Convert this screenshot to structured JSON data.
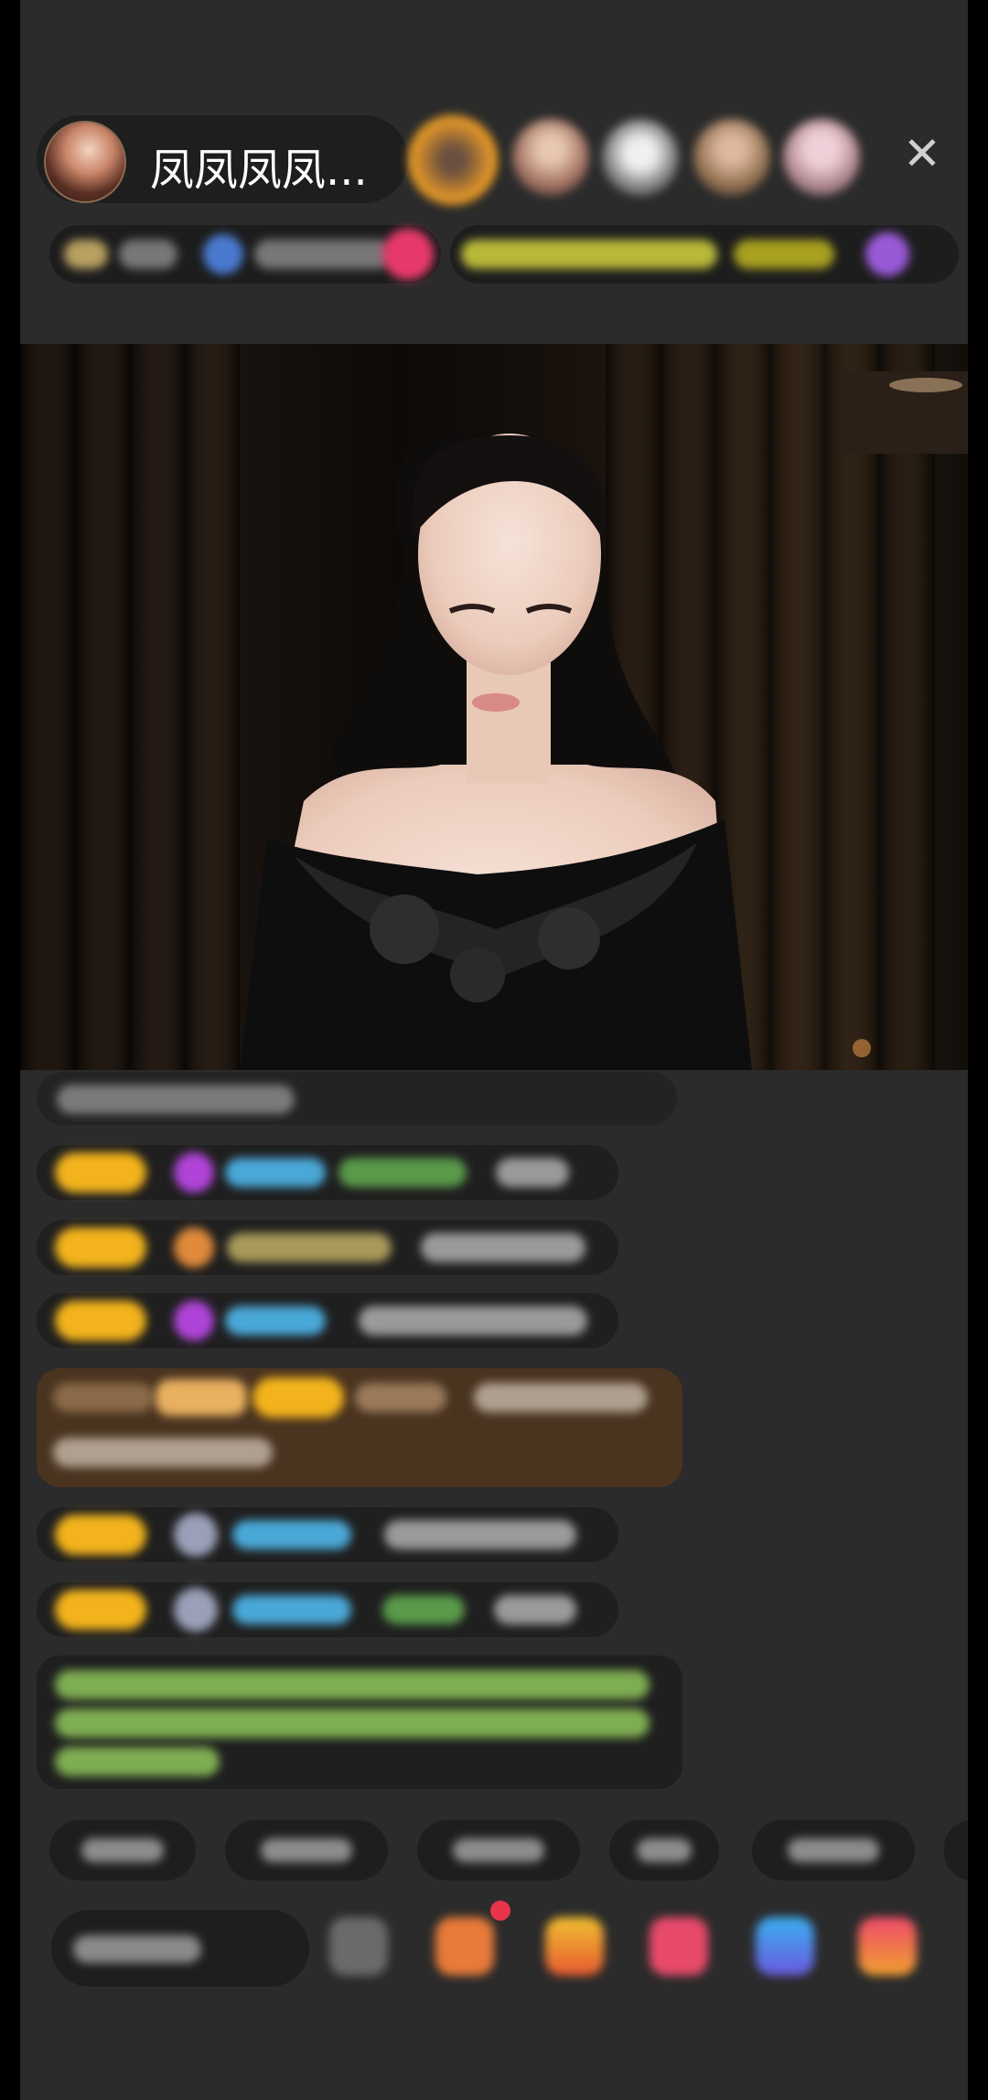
{
  "header": {
    "host_name": "凤凤凤凤...",
    "close_label": "✕"
  },
  "colors": {
    "background": "#2b2b2b",
    "badge_gold": "#f2b31c",
    "chat_green": "#9fd26a",
    "username_blue": "#4aa8d8"
  }
}
